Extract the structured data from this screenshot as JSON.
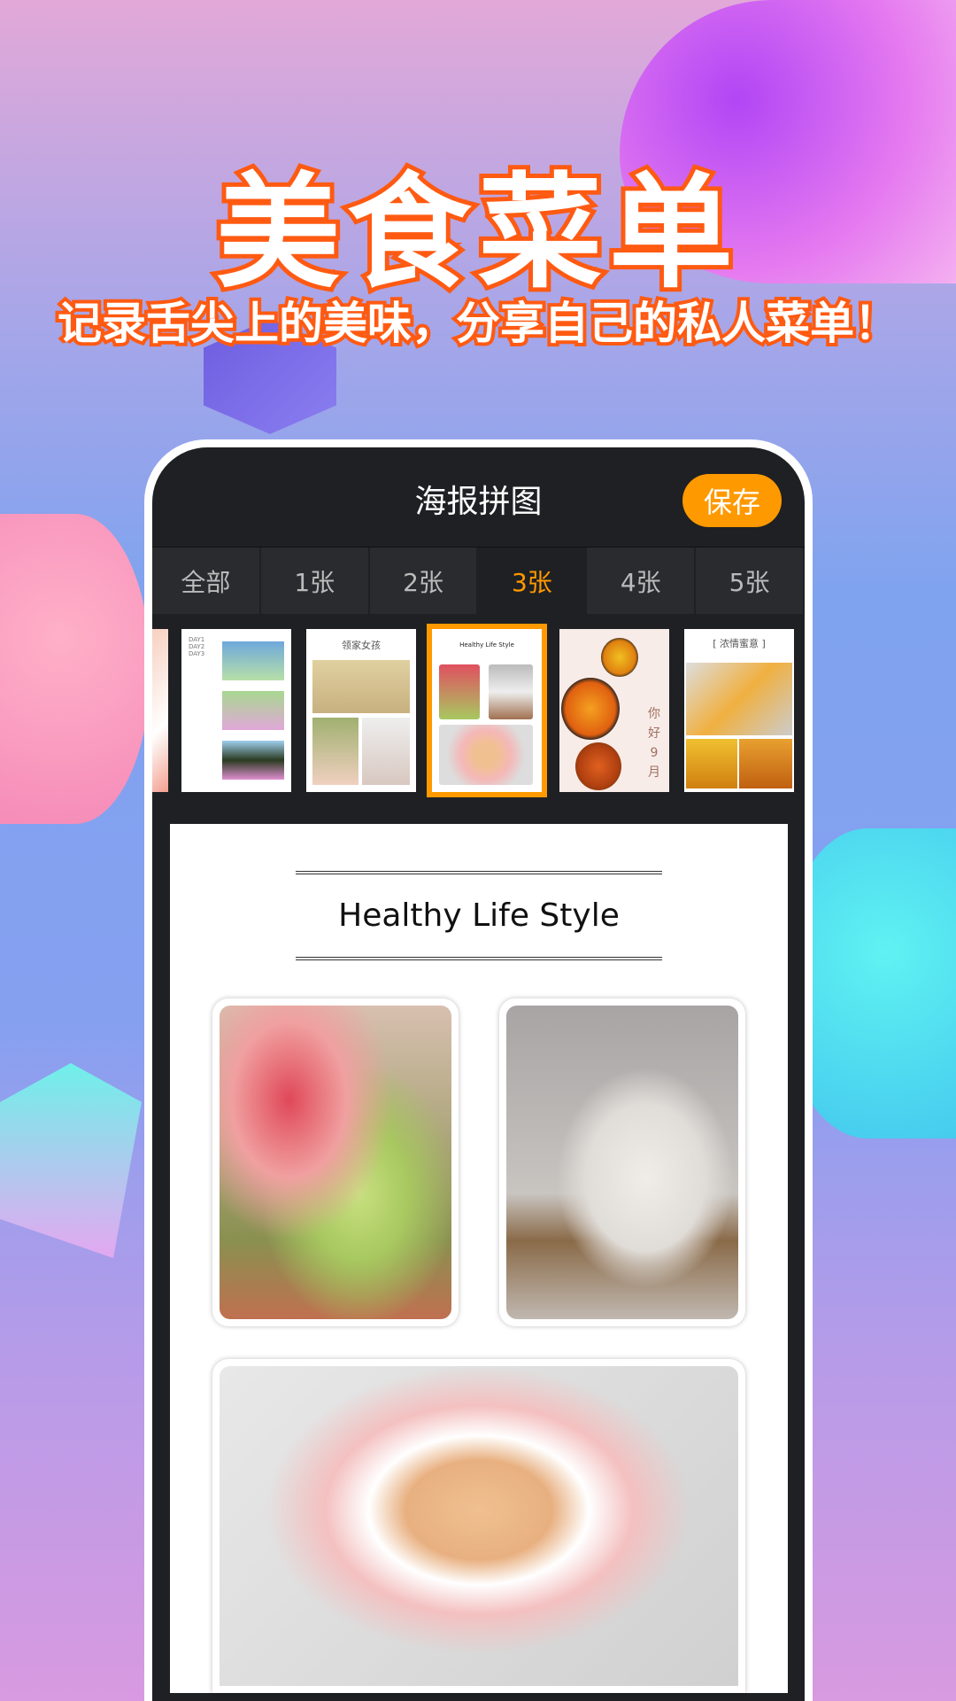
{
  "banner": {
    "title": "美食菜单",
    "subtitle": "记录舌尖上的美味，分享自己的私人菜单！"
  },
  "app": {
    "title": "海报拼图",
    "save_label": "保存"
  },
  "tabs": [
    {
      "label": "全部"
    },
    {
      "label": "1张"
    },
    {
      "label": "2张"
    },
    {
      "label": "3张",
      "active": true
    },
    {
      "label": "4张"
    },
    {
      "label": "5张"
    }
  ],
  "templates": [
    {
      "label": ""
    },
    {
      "label": "DAY1 DAY2 DAY3"
    },
    {
      "label": "领家女孩"
    },
    {
      "label": "Healthy Life Style",
      "selected": true
    },
    {
      "label": "你好 9月"
    },
    {
      "label": "[ 浓情蜜意 ]"
    }
  ],
  "poster": {
    "title": "Healthy Life Style"
  },
  "colors": {
    "accent": "#ff9900",
    "stroke": "#ff5a12",
    "dark": "#1f2023"
  }
}
